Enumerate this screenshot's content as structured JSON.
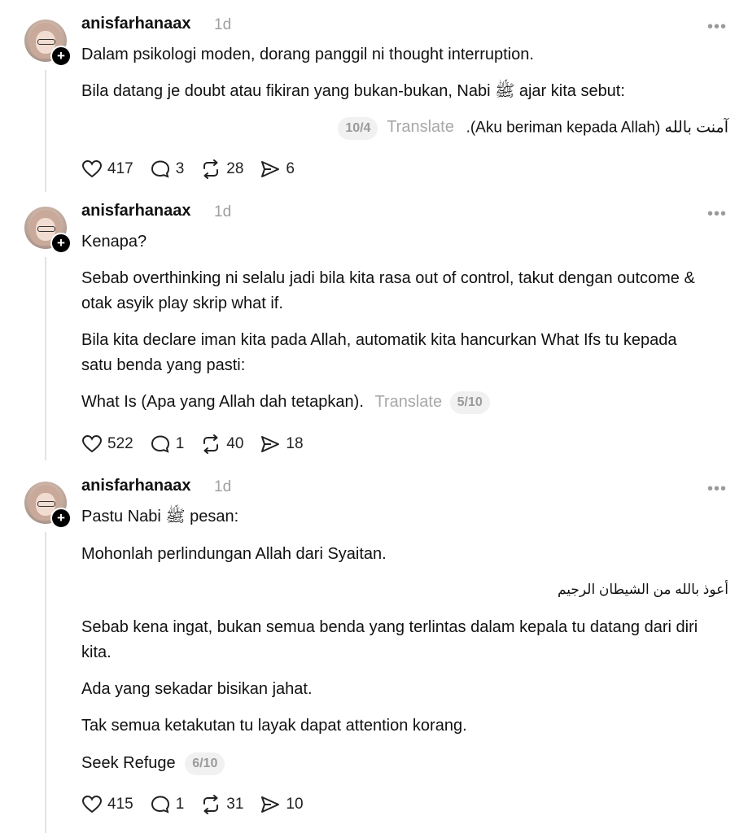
{
  "posts": [
    {
      "username": "anisfarhanaax",
      "time": "1d",
      "paragraphs": [
        "Dalam psikologi moden, dorang panggil ni thought interruption.",
        "Bila datang je doubt atau fikiran yang bukan-bukan, Nabi ﷺ ajar kita sebut:"
      ],
      "quote_line": {
        "page": "10/4",
        "translate": "Translate",
        "text": ".(Aku beriman kepada Allah) آمنت بالله"
      },
      "likes": "417",
      "comments": "3",
      "reposts": "28",
      "shares": "6"
    },
    {
      "username": "anisfarhanaax",
      "time": "1d",
      "paragraphs": [
        "Kenapa?",
        "Sebab overthinking ni selalu jadi bila kita rasa out of control, takut dengan outcome & otak asyik play skrip what if.",
        "Bila kita declare iman kita pada Allah, automatik kita hancurkan What Ifs tu kepada satu benda yang pasti:",
        "What Is (Apa yang Allah dah tetapkan)."
      ],
      "translate": "Translate",
      "page": "5/10",
      "likes": "522",
      "comments": "1",
      "reposts": "40",
      "shares": "18"
    },
    {
      "username": "anisfarhanaax",
      "time": "1d",
      "paragraphs": [
        "Pastu Nabi ﷺ pesan:",
        "Mohonlah perlindungan Allah dari Syaitan.",
        "أعوذ بالله من الشيطان الرجيم",
        "Sebab kena ingat, bukan semua benda yang terlintas dalam kepala tu datang dari diri kita.",
        "Ada yang sekadar bisikan jahat.",
        "Tak semua ketakutan tu layak dapat attention korang.",
        "Seek Refuge"
      ],
      "page": "6/10",
      "likes": "415",
      "comments": "1",
      "reposts": "31",
      "shares": "10"
    }
  ],
  "icons": {
    "like": "heart-icon",
    "comment": "comment-icon",
    "repost": "repost-icon",
    "share": "share-icon",
    "more": "more-icon",
    "follow": "plus-icon"
  }
}
